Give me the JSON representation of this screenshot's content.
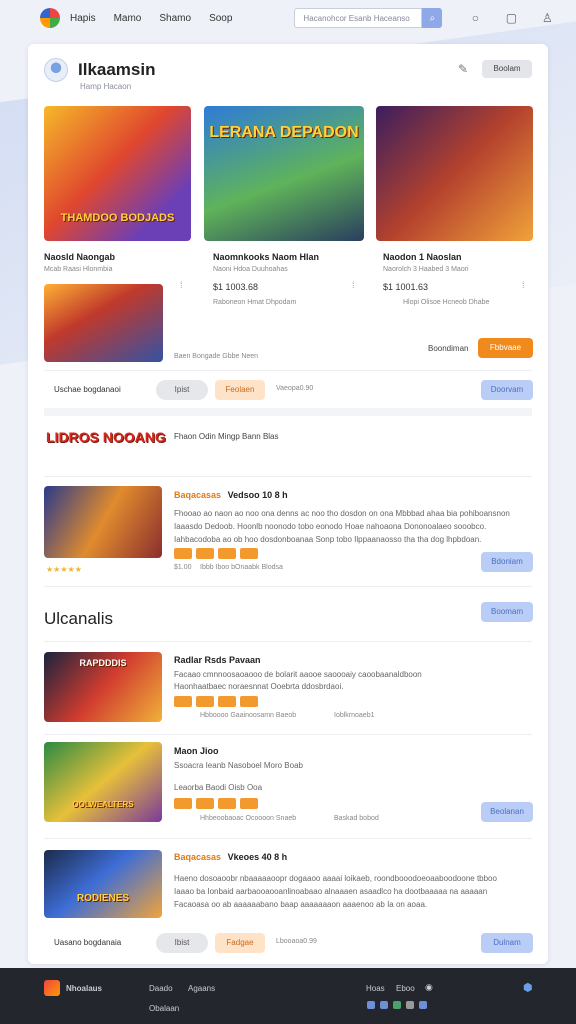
{
  "nav": {
    "items": [
      "Hapis",
      "Mamo",
      "Shamo",
      "Soop"
    ],
    "search_placeholder": "Hacanohcor Esanb Haceanso"
  },
  "header": {
    "title": "Ilkaamsin",
    "subtitle": "Hamp Hacaon",
    "button": "Boolam"
  },
  "featured": [
    {
      "thumb_text": "THAMDOO BODJADS",
      "title": "Naosld Naongab",
      "meta": "Mcab Raasi Hlonmbia"
    },
    {
      "thumb_text": "LERANA DEPADON",
      "title": "Naomnkooks Naom Hlan",
      "meta": "Naoni Hdoa Duuhoahas",
      "price": "$1 1003.68",
      "meta2": "Raboneon Hmat Dhpodam"
    },
    {
      "thumb_text": "",
      "title": "Naodon 1 Naoslan",
      "meta": "Naorolch 3 Haabed 3 Maori",
      "price": "$1 1001.63",
      "meta2": "Hlopi Olisoe Hcneob Dhabe"
    }
  ],
  "row2": {
    "meta": "Baen Bongade Gbbe Neen",
    "action_label": "Boondiman",
    "action_button": "Fbbvaae"
  },
  "filter_row1": {
    "label": "Uschae bogdanaoi",
    "btn_gray": "Ipist",
    "btn_peach": "Feolaen",
    "text": "Vaeopa0.90",
    "btn_blue": "Doorvam"
  },
  "promo": {
    "logo_text": "LIDROS NOOANG",
    "text": "Fhaon Odin Mingp Bann Blas"
  },
  "hero_card": {
    "title_hl": "Baqacasas",
    "title": "Vedsoo 10 8 h",
    "body": "Fhooao ao naon ao noo ona denns ac noo tho dosdon on ona Mbbbad ahaa bia pohiboansnon Iaaasdo Dedoob. Hoonlb noonodo tobo eonodo Hoae nahoaona Dononoalaeo sooobco. Iahbacodoba ao ob hoo dosdonboanaa Sonp tobo Ilppaanaosso tha tha dog lhpbdoan.",
    "rating_meta": "Ibbb Iboo bOnaabk Blodsa",
    "price": "$1.00",
    "button": "Bdoniam",
    "stars": "★★★★★"
  },
  "list_section": {
    "title": "Ulcanalis",
    "button": "Boomam"
  },
  "list": [
    {
      "thumb_text": "RAPDDDIS",
      "title": "Radlar Rsds Pavaan",
      "body": "Facaao cmnnoosaoaooo de bolarit aaooe saoooaiy caoobaanaldboon",
      "body2": "Haonhaatbaec noraesnnat Ooebrta ddosbrdaoi.",
      "meta": "Hbboooo Gaainoosamn Baeob",
      "meta2": "Ioblkrnoaeb1"
    },
    {
      "thumb_text": "OOLWEALTERS",
      "title": "Maon Jioo",
      "body": "Ssoacra Ieanb Nasoboel Moro Boab",
      "body2": "Leaorba Baodi Oisb Ooa",
      "meta": "Hhbeoobaoac Ocoooon Snaeb",
      "meta2": "Baskad bobod",
      "button": "Beolanan"
    },
    {
      "thumb_text": "RODIENES",
      "title_hl": "Baqacasas",
      "title": "Vkeoes 40 8 h",
      "body": "Haeno dosoaoobr nbaaaaaoopr dogaaoo aaaai loikaeb, roondbooodoeoaaboodoone tbboo",
      "body2": "Iaaao ba Ionbaid aarbaooaooanlinoabaao alnaaaen asaadlco ha dootbaaaaa na aaaaan",
      "body3": "Facaoasa oo ab aaaaaabano baap aaaaaaaon aaaenoo ab Ia on aoaa."
    }
  ],
  "filter_row2": {
    "label": "Uasano bogdanaia",
    "btn_gray": "Ibist",
    "btn_peach": "Fadgae",
    "text": "Lbooaoa0.99",
    "btn_blue": "Dulnam"
  },
  "footer": {
    "brand": "Nhoalaus",
    "links": [
      "Daado",
      "Agaans",
      "Obalaan"
    ],
    "right_links": [
      "Hoas",
      "Eboo"
    ]
  },
  "colors": {
    "accent_orange": "#f08a1c",
    "accent_blue": "#b9cdf7",
    "footer_bg": "#23262d"
  }
}
